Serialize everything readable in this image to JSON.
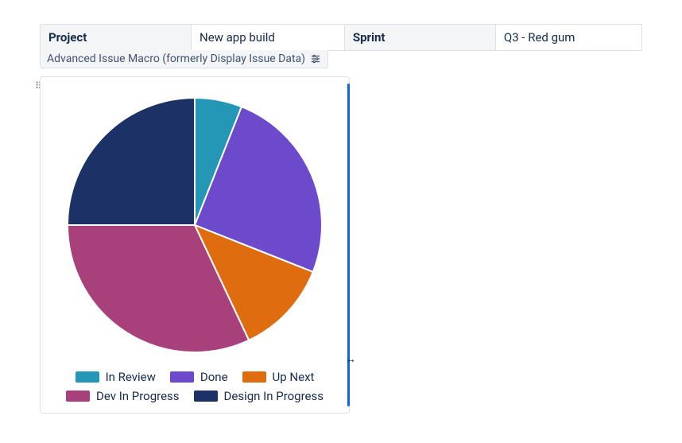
{
  "header_table": {
    "rows": [
      {
        "label": "Project",
        "value": "New app build"
      },
      {
        "label": "Sprint",
        "value": "Q3 - Red gum"
      }
    ]
  },
  "macro_bar": {
    "label": "Advanced Issue Macro (formerly Display Issue Data)"
  },
  "chart_data": {
    "type": "pie",
    "title": "",
    "series": [
      {
        "name": "In Review",
        "value": 6,
        "color": "#2497b6"
      },
      {
        "name": "Done",
        "value": 25,
        "color": "#6c4acb"
      },
      {
        "name": "Up Next",
        "value": 12,
        "color": "#e06c10"
      },
      {
        "name": "Dev In Progress",
        "value": 32,
        "color": "#a8407b"
      },
      {
        "name": "Design In Progress",
        "value": 25,
        "color": "#1c3266"
      }
    ],
    "inner_radius": 0,
    "outer_radius": 160
  }
}
